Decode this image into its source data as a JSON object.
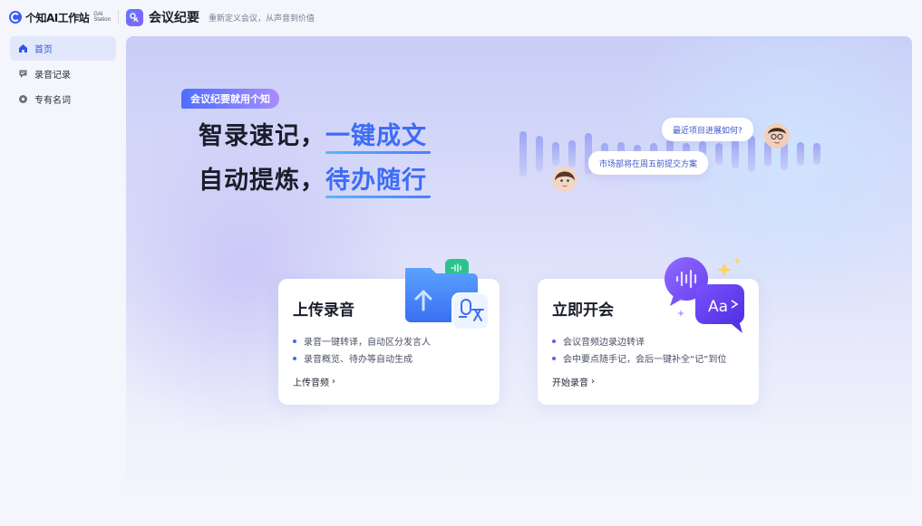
{
  "topbar": {
    "brand_name": "个知AI工作站",
    "brand_sub_1": "GAI",
    "brand_sub_2": "Station",
    "app_title": "会议纪要",
    "app_slogan": "重新定义会议，从声音到价值"
  },
  "sidebar": {
    "items": [
      {
        "label": "首页",
        "icon": "home-icon",
        "active": true
      },
      {
        "label": "录音记录",
        "icon": "recording-list-icon",
        "active": false
      },
      {
        "label": "专有名词",
        "icon": "glossary-icon",
        "active": false
      }
    ]
  },
  "hero": {
    "badge": "会议纪要就用个知",
    "line1_plain": "智录速记，",
    "line1_highlight": "一键成文",
    "line2_plain": "自动提炼，",
    "line2_highlight": "待办随行",
    "bubble_1": "最近项目进展如何?",
    "bubble_2": "市场部将在周五前提交方案"
  },
  "cards": [
    {
      "title": "上传录音",
      "bullets": [
        "录音一键转译，自动区分发言人",
        "录音概览、待办等自动生成"
      ],
      "link": "上传音频"
    },
    {
      "title": "立即开会",
      "bullets": [
        "会议音频边录边转译",
        "会中要点随手记，会后一键补全“记”到位"
      ],
      "link": "开始录音"
    }
  ],
  "colors": {
    "accent": "#3d6cf6",
    "bullet_blue": "#3f6df5",
    "bullet_purple": "#7b53f0",
    "sidebar_active_bg": "#e2e8fb"
  }
}
